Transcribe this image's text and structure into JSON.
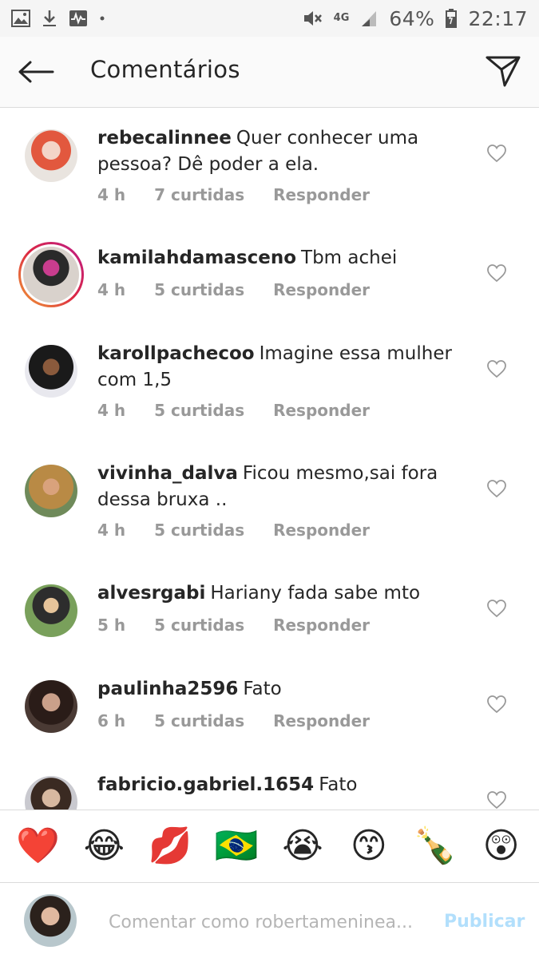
{
  "status_bar": {
    "network": "4G",
    "battery": "64%",
    "time": "22:17",
    "icons_left": [
      "image-icon",
      "download-icon",
      "activity-icon",
      "dot-icon"
    ],
    "icons_right": [
      "mute-icon",
      "signal-icon",
      "battery-icon"
    ]
  },
  "header": {
    "title": "Comentários",
    "back_icon": "arrow-left-icon",
    "send_icon": "paper-plane-icon"
  },
  "comments": [
    {
      "username": "rebecalinnee",
      "text": "Quer conhecer uma pessoa? Dê poder a ela.",
      "time": "4 h",
      "likes": "7 curtidas",
      "reply": "Responder"
    },
    {
      "username": "kamilahdamasceno",
      "text": "Tbm achei",
      "time": "4 h",
      "likes": "5 curtidas",
      "reply": "Responder"
    },
    {
      "username": "karollpachecoo",
      "text": "Imagine essa mulher com 1,5",
      "time": "4 h",
      "likes": "5 curtidas",
      "reply": "Responder"
    },
    {
      "username": "vivinha_dalva",
      "text": "Ficou mesmo,sai fora dessa bruxa ..",
      "time": "4 h",
      "likes": "5 curtidas",
      "reply": "Responder"
    },
    {
      "username": "alvesrgabi",
      "text": "Hariany fada sabe mto",
      "time": "5 h",
      "likes": "5 curtidas",
      "reply": "Responder"
    },
    {
      "username": "paulinha2596",
      "text": "Fato",
      "time": "6 h",
      "likes": "5 curtidas",
      "reply": "Responder"
    },
    {
      "username": "fabricio.gabriel.1654",
      "text": "Fato",
      "time": "",
      "likes": "",
      "reply": ""
    }
  ],
  "emoji_bar": [
    "❤️",
    "😂",
    "💋",
    "🇧🇷",
    "😭",
    "😙",
    "🍾",
    "😲"
  ],
  "composer": {
    "placeholder": "Comentar como robertameninea...",
    "publish": "Publicar"
  },
  "colors": {
    "accent_disabled": "#b2dffc",
    "meta_gray": "#999999",
    "divider": "#dbdbdb"
  }
}
